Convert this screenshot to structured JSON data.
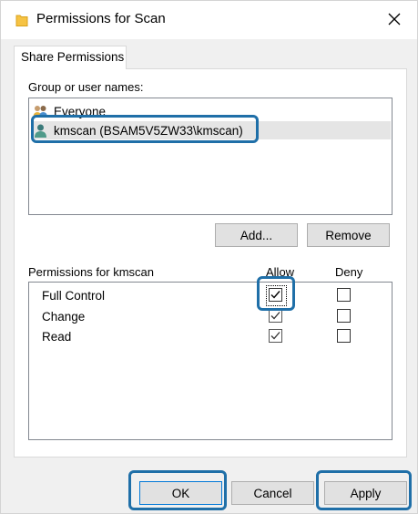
{
  "window": {
    "title": "Permissions for Scan",
    "close_icon": "close-icon",
    "folder_icon": "folder-icon"
  },
  "tabs": [
    {
      "label": "Share Permissions",
      "active": true
    }
  ],
  "group_section": {
    "label": "Group or user names:",
    "users": [
      {
        "name": "Everyone",
        "icon": "group-icon",
        "selected": false
      },
      {
        "name": "kmscan (BSAM5V5ZW33\\kmscan)",
        "icon": "user-icon",
        "selected": true
      }
    ],
    "add_label": "Add...",
    "remove_label": "Remove"
  },
  "permissions_section": {
    "label": "Permissions for kmscan",
    "allow_header": "Allow",
    "deny_header": "Deny",
    "rows": [
      {
        "name": "Full Control",
        "allow": true,
        "deny": false
      },
      {
        "name": "Change",
        "allow": true,
        "deny": false
      },
      {
        "name": "Read",
        "allow": true,
        "deny": false
      }
    ]
  },
  "footer": {
    "ok_label": "OK",
    "cancel_label": "Cancel",
    "apply_label": "Apply"
  },
  "colors": {
    "highlight": "#1f6fa8",
    "selection": "#e5e5e5",
    "button_face": "#e1e1e1",
    "folder": "#f6c344"
  }
}
